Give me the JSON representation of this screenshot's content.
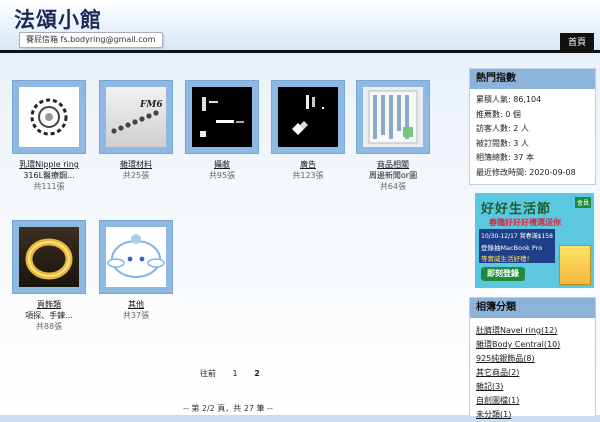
{
  "site": {
    "title": "法頌小館",
    "email": "賽屁信箱 fs.bodyring@gmail.com",
    "home_label": "首頁"
  },
  "albums": [
    {
      "name": "乳環Nipple ring",
      "desc": "316L醫療鋼...",
      "count": "共111張"
    },
    {
      "name": "雜環材料",
      "desc": "",
      "count": "共25張"
    },
    {
      "name": "攝敝",
      "desc": "",
      "count": "共95張"
    },
    {
      "name": "廣告",
      "desc": "",
      "count": "共123張"
    },
    {
      "name": "商品相關",
      "desc": "周邊新聞or圖",
      "count": "共64張"
    },
    {
      "name": "頁飾類",
      "desc": "項探、手鍊...",
      "count": "共88張"
    },
    {
      "name": "其他",
      "desc": "",
      "count": "共37張"
    }
  ],
  "pagination": {
    "prev_label": "往前",
    "pages": [
      "1",
      "2"
    ],
    "current": "2",
    "summary": "-- 第 2/2 頁，共 27 筆 --"
  },
  "stats": {
    "title": "熱門指數",
    "rows": [
      "累積人氣: 86,104",
      "推薦數: 0 個",
      "訪客人數: 2 人",
      "被訂閱數: 3 人",
      "相簿總數: 37 本",
      "最近修改時間: 2020-09-08"
    ]
  },
  "ad": {
    "headline": "好好生活節",
    "subline": "春臨好好好禮選送你",
    "dates": "10/30-12/17 賞春滿$158",
    "line2": "登錄抽MacBook Pro",
    "line3": "等實威生活好禮！",
    "cta": "即刻登錄",
    "badge": "會員"
  },
  "categories": {
    "title": "相簿分類",
    "items": [
      "肚臍環Navel ring(12)",
      "雜環Body Central(10)",
      "925純銀飾品(8)",
      "其它商品(2)",
      "雜記(3)",
      "自創圖檔(1)",
      "未分類(1)"
    ]
  },
  "colors": {
    "accent": "#8cb3da",
    "frame": "#8fb8e2",
    "header_bar": "#111111",
    "title": "#1a2b55"
  }
}
